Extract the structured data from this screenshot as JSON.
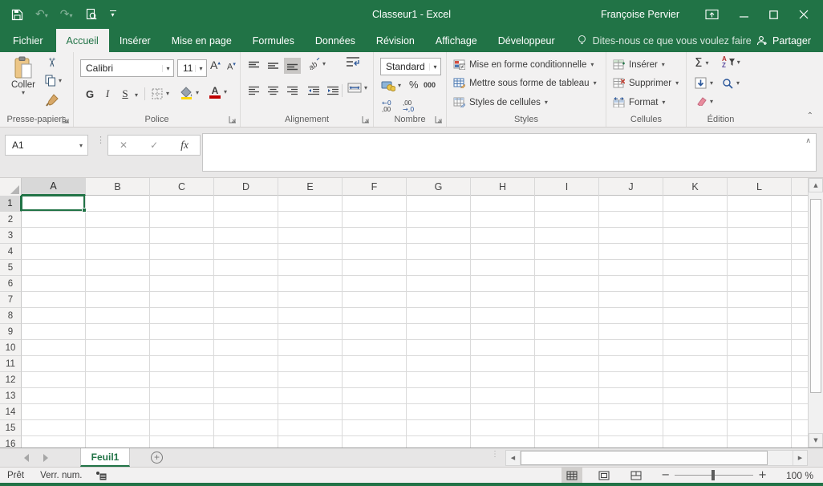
{
  "colors": {
    "accent": "#217346",
    "font_color_red": "#c00000",
    "fill_color_yellow": "#ffd800"
  },
  "titlebar": {
    "title": "Classeur1  -  Excel",
    "user": "Françoise Pervier"
  },
  "tabs": [
    {
      "label": "Fichier"
    },
    {
      "label": "Accueil"
    },
    {
      "label": "Insérer"
    },
    {
      "label": "Mise en page"
    },
    {
      "label": "Formules"
    },
    {
      "label": "Données"
    },
    {
      "label": "Révision"
    },
    {
      "label": "Affichage"
    },
    {
      "label": "Développeur"
    }
  ],
  "tell_me": "Dites-nous ce que vous voulez faire",
  "share_label": "Partager",
  "ribbon": {
    "clipboard": {
      "label": "Presse-papiers",
      "paste": "Coller"
    },
    "font": {
      "label": "Police",
      "name": "Calibri",
      "size": "11",
      "bold": "G",
      "italic": "I",
      "underline": "S"
    },
    "alignment": {
      "label": "Alignement"
    },
    "number": {
      "label": "Nombre",
      "format": "Standard",
      "percent": "%",
      "thousands": "000",
      "inc_top": "←0",
      "inc_bottom": ",00",
      "dec_top": ",00",
      "dec_bottom": "→,0"
    },
    "styles": {
      "label": "Styles",
      "conditional": "Mise en forme conditionnelle",
      "format_table": "Mettre sous forme de tableau",
      "cell_styles": "Styles de cellules"
    },
    "cells": {
      "label": "Cellules",
      "insert": "Insérer",
      "delete": "Supprimer",
      "format": "Format"
    },
    "editing": {
      "label": "Édition",
      "sum": "Σ",
      "sort_a": "A",
      "sort_z": "Z"
    }
  },
  "formula_bar": {
    "cell_ref": "A1",
    "fx": "fx"
  },
  "grid": {
    "columns": [
      "A",
      "B",
      "C",
      "D",
      "E",
      "F",
      "G",
      "H",
      "I",
      "J",
      "K",
      "L"
    ],
    "rows": [
      "1",
      "2",
      "3",
      "4",
      "5",
      "6",
      "7",
      "8",
      "9",
      "10",
      "11",
      "12",
      "13",
      "14",
      "15",
      "16"
    ],
    "selected_cell": "A1"
  },
  "sheet_bar": {
    "tabs": [
      {
        "label": "Feuil1",
        "active": true
      }
    ]
  },
  "status_bar": {
    "mode": "Prêt",
    "num_lock": "Verr. num.",
    "zoom_level": "100 %"
  }
}
